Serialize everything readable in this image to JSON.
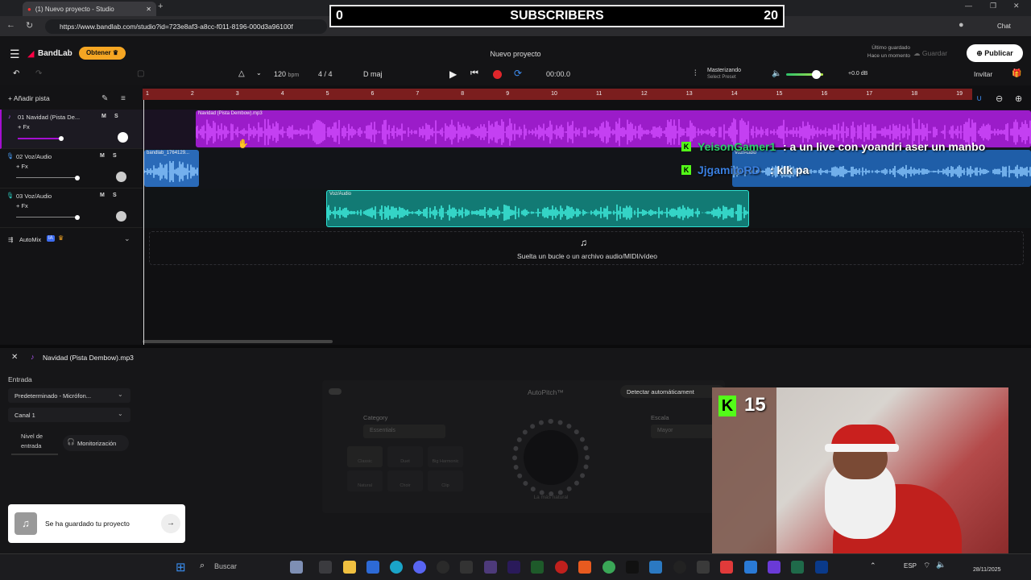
{
  "browser": {
    "tab_title": "(1) Nuevo proyecto - Studio",
    "url": "https://www.bandlab.com/studio?id=723e8af3-a8cc-f011-8196-000d3a96100f",
    "chat_label": "Chat"
  },
  "overlay": {
    "subs_left": "0",
    "subs_title": "SUBSCRIBERS",
    "subs_right": "20",
    "kick_count": "15",
    "chat": [
      {
        "user": "YeisonGamer1",
        "msg": ": a un live con yoandri aser un manbo"
      },
      {
        "user": "JjgamitoRD",
        "msg": ": klk pa"
      }
    ]
  },
  "app": {
    "logo": "BandLab",
    "obtener": "Obtener",
    "project_title": "Nuevo proyecto",
    "last_saved_1": "Último guardado",
    "last_saved_2": "Hace un momento",
    "save": "Guardar",
    "publish": "Publicar",
    "invite": "Invitar",
    "tempo": "120",
    "tempo_unit": "bpm",
    "time_sig": "4 / 4",
    "key": "D maj",
    "time": "00:00.0",
    "mastering_1": "Masterizando",
    "mastering_2": "Select Preset",
    "volume_db": "+0.0 dB",
    "add_track": "Añadir pista",
    "automix": "AutoMix",
    "automix_badge": "IA",
    "drop_text": "Suelta un bucle o un archivo audio/MIDI/vídeo",
    "ruler": [
      "1",
      "2",
      "3",
      "4",
      "5",
      "6",
      "7",
      "8",
      "9",
      "10",
      "11",
      "12",
      "13",
      "14",
      "15",
      "16",
      "17",
      "18",
      "19"
    ],
    "tracks": [
      {
        "name": "01 Navidad (Pista De...",
        "fx": "+ Fx",
        "m": "M",
        "s": "S"
      },
      {
        "name": "02 Voz/Audio",
        "fx": "+ Fx",
        "m": "M",
        "s": "S"
      },
      {
        "name": "03 Voz/Audio",
        "fx": "+ Fx",
        "m": "M",
        "s": "S"
      }
    ],
    "clips": {
      "c1": "Navidad (Pista Dembow).mp3",
      "c2": "bandlab_1764129...",
      "c3": "Voz/Audio",
      "c4": "Voz/Audio"
    }
  },
  "panel": {
    "file": "Navidad (Pista Dembow).mp3",
    "entrada": "Entrada",
    "device": "Predeterminado - Micrófon...",
    "canal": "Canal 1",
    "nivel": "Nivel de entrada",
    "monitor": "Monitorización",
    "autopitch": "AutoPitch™",
    "detect": "Detectar automáticament",
    "category": "Category",
    "category_val": "Essentials",
    "escala": "Escala",
    "escala_val": "Mayor",
    "presets": [
      "Classic",
      "Duet",
      "Big Harmonic",
      "Natural",
      "Choir",
      "Clip"
    ],
    "knob_label": "La más natural",
    "toast": "Se ha guardado tu proyecto"
  },
  "taskbar": {
    "search": "Buscar",
    "lang": "ESP",
    "date": "28/11/2025"
  }
}
